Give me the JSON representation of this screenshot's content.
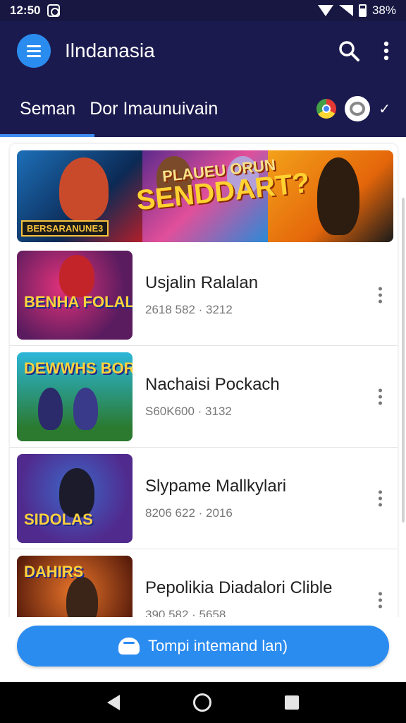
{
  "status_bar": {
    "time": "12:50",
    "battery": "38%"
  },
  "app_bar": {
    "title": "Ilndanasia"
  },
  "tabs": [
    {
      "label": "Seman"
    },
    {
      "label": "Dor Imaunuivain"
    }
  ],
  "banner": {
    "tag": "BERSARANUNE3",
    "title_top": "PLAUEU ORUN",
    "title_main": "SENDDART?"
  },
  "items": [
    {
      "title": "Usjalin Ralalan",
      "meta": "2618 582 · 3212",
      "thumb_tag": "BENHA FOLALS"
    },
    {
      "title": "Nachaisi Pockach",
      "meta": "S60K600 · 3132",
      "thumb_tag": "DEWWHS BORDNIS"
    },
    {
      "title": "Slypame Mallkylari",
      "meta": "8206 622 · 2016",
      "thumb_tag": "SIDOLAS"
    },
    {
      "title": "Pepolikia Diadalori Clible",
      "meta": "390 582 · 5658",
      "thumb_tag": "DAHIRS"
    }
  ],
  "primary_button": {
    "label": "Tompi intemand lan)"
  },
  "colors": {
    "primary": "#2b8cf0",
    "header": "#1b1a4e"
  }
}
